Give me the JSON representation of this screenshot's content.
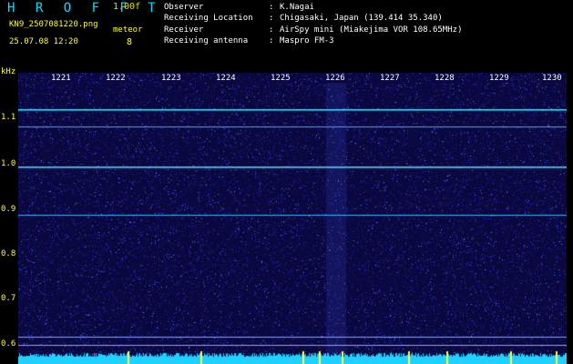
{
  "header": {
    "app_title": "H R O F F T",
    "version": "1.00f",
    "filename": "KN9_2507081220.png",
    "datetime": "25.07.08 12:20",
    "meteor_label": "meteor",
    "meteor_count": "8",
    "info": [
      {
        "label": "Observer",
        "sep": ":",
        "value": "K.Nagai"
      },
      {
        "label": "Receiving Location",
        "sep": ":",
        "value": "Chigasaki, Japan (139.414 35.340)"
      },
      {
        "label": "Receiver",
        "sep": ":",
        "value": "AirSpy mini (Miakejima VOR 108.65MHz)"
      },
      {
        "label": "Receiving antenna",
        "sep": ":",
        "value": "Maspro FM-3"
      }
    ]
  },
  "axes": {
    "y_unit": "kHz",
    "x_ticks": [
      "1221",
      "1222",
      "1223",
      "1224",
      "1225",
      "1226",
      "1227",
      "1228",
      "1229",
      "1230"
    ],
    "y_ticks": [
      "1.1",
      "1.0",
      "0.9",
      "0.8",
      "0.7",
      "0.6"
    ]
  },
  "colors": {
    "background": "#0b0840",
    "noise": "#2a3ad0",
    "signal": "#40e8ff",
    "bottom_band": "#20d0ff"
  }
}
